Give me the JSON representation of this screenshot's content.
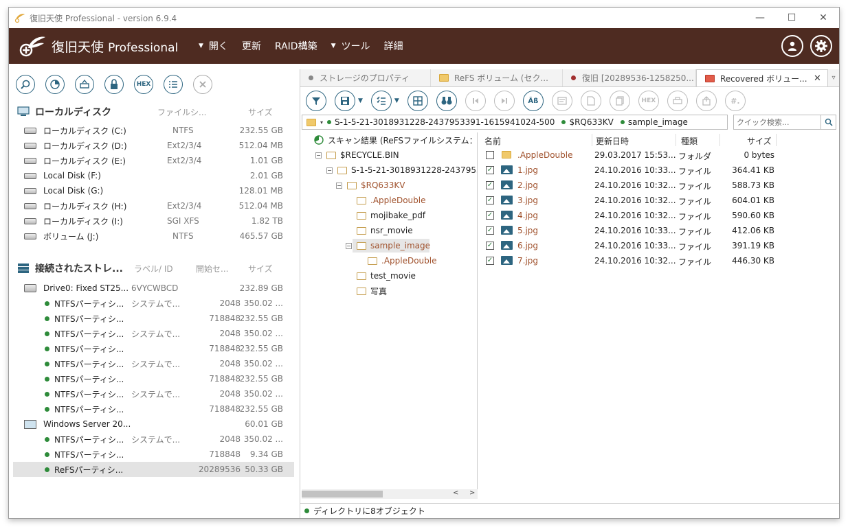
{
  "window": {
    "title": "復旧天使 Professional - version 6.9.4",
    "controls": [
      "—",
      "☐",
      "✕"
    ]
  },
  "menubar": {
    "brand_jp": "復旧天使",
    "brand_en": "Professional",
    "items": [
      "開く",
      "更新",
      "RAID構築",
      "ツール",
      "詳細"
    ],
    "caret": "▼"
  },
  "local_disks": {
    "title": "ローカルディスク",
    "col_fs": "ファイルシ...",
    "col_size": "サイズ",
    "items": [
      {
        "name": "ローカルディスク (C:)",
        "fs": "NTFS",
        "size": "232.55 GB"
      },
      {
        "name": "ローカルディスク (D:)",
        "fs": "Ext2/3/4",
        "size": "512.04 MB"
      },
      {
        "name": "ローカルディスク (E:)",
        "fs": "Ext2/3/4",
        "size": "1.01 GB"
      },
      {
        "name": "Local Disk (F:)",
        "fs": "",
        "size": "2.01 GB"
      },
      {
        "name": "Local Disk (G:)",
        "fs": "",
        "size": "128.01 MB"
      },
      {
        "name": "ローカルディスク (H:)",
        "fs": "Ext2/3/4",
        "size": "512.04 MB"
      },
      {
        "name": "ローカルディスク (I:)",
        "fs": "SGI XFS",
        "size": "1.82 TB"
      },
      {
        "name": "ボリューム (J:)",
        "fs": "NTFS",
        "size": "465.57 GB"
      }
    ]
  },
  "storage": {
    "title": "接続されたストレ...",
    "col_label": "ラベル/ ID",
    "col_start": "開始セ...",
    "col_size": "サイズ",
    "drive0": {
      "name": "Drive0: Fixed ST25...",
      "id": "6VYCWBCD",
      "size": "232.89 GB"
    },
    "drive0_parts": [
      {
        "name": "NTFSパーティシ...",
        "label": "システムで...",
        "start": "2048",
        "size": "350.02 ..."
      },
      {
        "name": "NTFSパーティシ...",
        "label": "",
        "start": "718848",
        "size": "232.55 GB"
      },
      {
        "name": "NTFSパーティシ...",
        "label": "システムで...",
        "start": "2048",
        "size": "350.02 ..."
      },
      {
        "name": "NTFSパーティシ...",
        "label": "",
        "start": "718848",
        "size": "232.55 GB"
      },
      {
        "name": "NTFSパーティシ...",
        "label": "システムで...",
        "start": "2048",
        "size": "350.02 ..."
      },
      {
        "name": "NTFSパーティシ...",
        "label": "",
        "start": "718848",
        "size": "232.55 GB"
      },
      {
        "name": "NTFSパーティシ...",
        "label": "システムで...",
        "start": "2048",
        "size": "350.02 ..."
      },
      {
        "name": "NTFSパーティシ...",
        "label": "",
        "start": "718848",
        "size": "232.55 GB"
      }
    ],
    "drive1": {
      "name": "Windows Server 20...",
      "size": "60.01 GB"
    },
    "drive1_parts": [
      {
        "name": "NTFSパーティシ...",
        "label": "システムで...",
        "start": "2048",
        "size": "350.02 ..."
      },
      {
        "name": "NTFSパーティシ...",
        "label": "",
        "start": "718848",
        "size": "9.34 GB"
      },
      {
        "name": "ReFSパーティシ...",
        "label": "",
        "start": "20289536",
        "size": "50.33 GB"
      }
    ]
  },
  "tabs": [
    {
      "label": "ストレージのプロパティ"
    },
    {
      "label": "ReFS ボリューム (セク..."
    },
    {
      "label": "復旧 [20289536-1258250..."
    },
    {
      "label": "Recovered ボリュー..."
    }
  ],
  "tab_close": "✕",
  "path": {
    "segments": [
      "S-1-5-21-3018931228-2437953391-1615941024-500",
      "$RQ633KV",
      "sample_image"
    ]
  },
  "search": {
    "placeholder": "クイック検索..."
  },
  "tree": {
    "root": "スキャン結果 (ReFSファイルシステム：",
    "recycle": "$RECYCLE.BIN",
    "sid": "S-1-5-21-3018931228-24379533",
    "rq": "$RQ633KV",
    "children": [
      ".AppleDouble",
      "mojibake_pdf",
      "nsr_movie",
      "sample_image",
      ".AppleDouble",
      "test_movie",
      "写真"
    ]
  },
  "files": {
    "col_name": "名前",
    "col_date": "更新日時",
    "col_type": "種類",
    "col_size": "サイズ",
    "rows": [
      {
        "name": ".AppleDouble",
        "date": "29.03.2017 15:53...",
        "type": "フォルダ",
        "size": "0 bytes",
        "checked": false,
        "folder": true
      },
      {
        "name": "1.jpg",
        "date": "24.10.2016 10:33...",
        "type": "ファイル",
        "size": "364.41 KB",
        "checked": true,
        "folder": false
      },
      {
        "name": "2.jpg",
        "date": "24.10.2016 10:32...",
        "type": "ファイル",
        "size": "588.73 KB",
        "checked": true,
        "folder": false
      },
      {
        "name": "3.jpg",
        "date": "24.10.2016 10:32...",
        "type": "ファイル",
        "size": "604.01 KB",
        "checked": true,
        "folder": false
      },
      {
        "name": "4.jpg",
        "date": "24.10.2016 10:32...",
        "type": "ファイル",
        "size": "590.60 KB",
        "checked": true,
        "folder": false
      },
      {
        "name": "5.jpg",
        "date": "24.10.2016 10:33...",
        "type": "ファイル",
        "size": "412.06 KB",
        "checked": true,
        "folder": false
      },
      {
        "name": "6.jpg",
        "date": "24.10.2016 10:33...",
        "type": "ファイル",
        "size": "391.19 KB",
        "checked": true,
        "folder": false
      },
      {
        "name": "7.jpg",
        "date": "24.10.2016 10:32...",
        "type": "ファイル",
        "size": "446.30 KB",
        "checked": true,
        "folder": false
      }
    ]
  },
  "status": {
    "text": "ディレクトリに8オブジェクト"
  },
  "hex_label": "HEX",
  "colors": {
    "menubar": "#4e2b21",
    "accent": "#2d6580",
    "status_green": "#2e8b3a"
  }
}
